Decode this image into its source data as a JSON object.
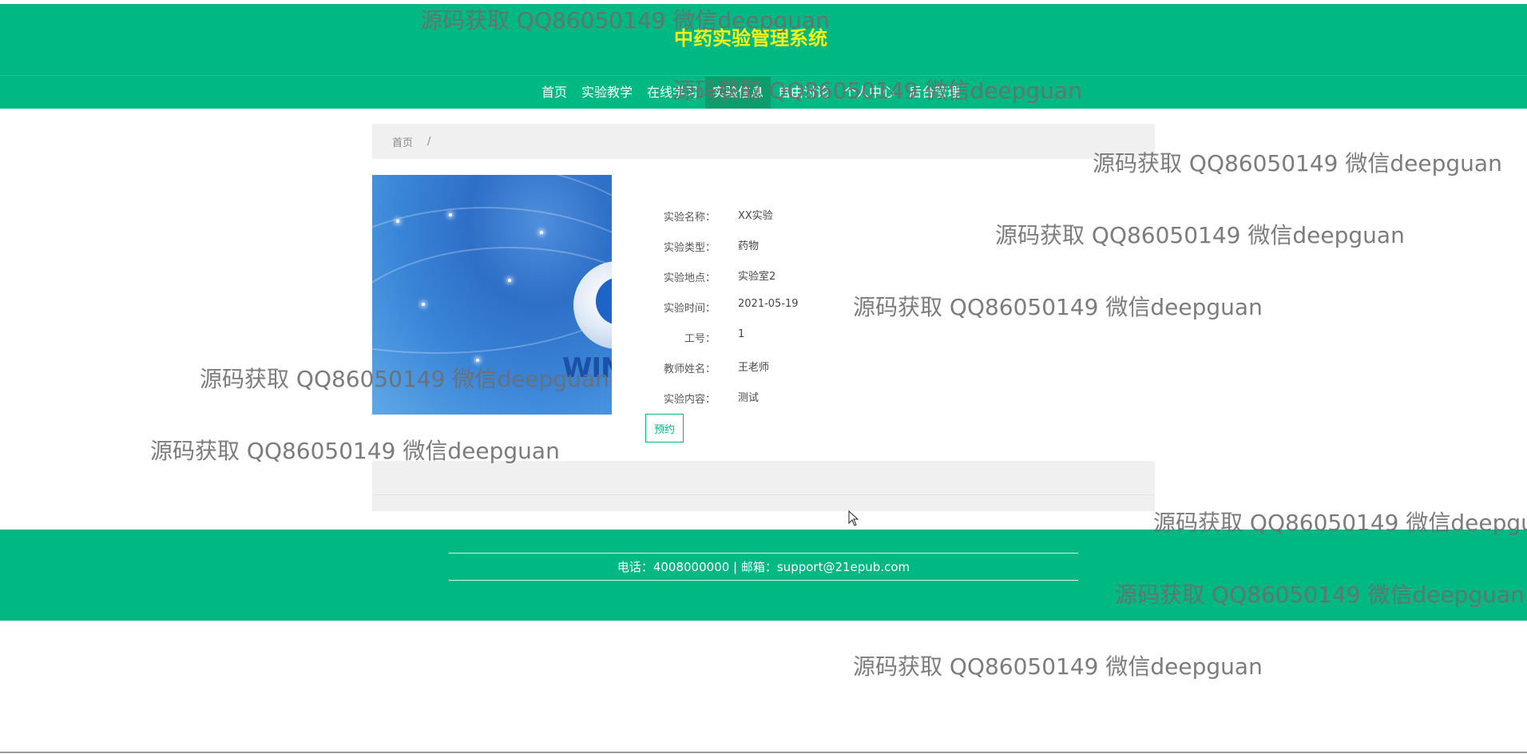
{
  "theme": {
    "accent": "#00b882",
    "title_color": "#f5f11a"
  },
  "header": {
    "title": "中药实验管理系统"
  },
  "nav": {
    "items": [
      {
        "label": "首页"
      },
      {
        "label": "实验教学"
      },
      {
        "label": "在线学习"
      },
      {
        "label": "实验信息"
      },
      {
        "label": "自由讨论"
      },
      {
        "label": "个人中心"
      },
      {
        "label": "后台管理"
      }
    ],
    "active": "实验信息"
  },
  "breadcrumb": {
    "home": "首页",
    "separator": "/"
  },
  "detail": {
    "image_logo_text": "WIN",
    "fields": [
      {
        "label": "实验名称：",
        "value": "XX实验"
      },
      {
        "label": "实验类型：",
        "value": "药物"
      },
      {
        "label": "实验地点：",
        "value": "实验室2"
      },
      {
        "label": "实验时间：",
        "value": "2021-05-19"
      },
      {
        "label": "工号：",
        "value": "1"
      },
      {
        "label": "教师姓名：",
        "value": "王老师"
      },
      {
        "label": "实验内容：",
        "value": "测试"
      }
    ],
    "book_button": "预约"
  },
  "footer": {
    "contact": "电话：4008000000 | 邮箱：support@21epub.com"
  },
  "watermark": {
    "text": "源码获取 QQ86050149 微信deepguan"
  }
}
